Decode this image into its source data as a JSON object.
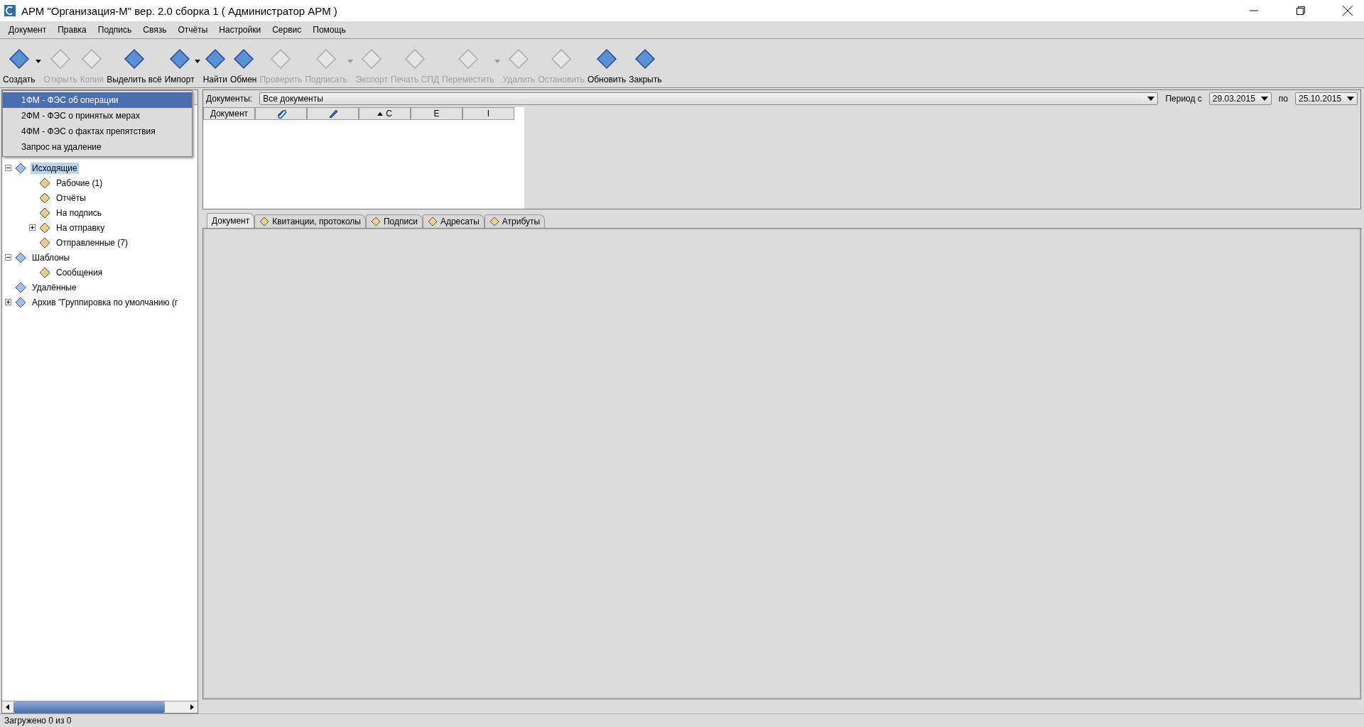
{
  "window": {
    "title": "АРМ \"Организация-М\" вер. 2.0 сборка 1 ( Администратор АРМ )"
  },
  "menu_bar": [
    "Документ",
    "Правка",
    "Подпись",
    "Связь",
    "Отчёты",
    "Настройки",
    "Сервис",
    "Помощь"
  ],
  "toolbar": {
    "buttons": [
      {
        "label": "Создать",
        "disabled": false,
        "dropdown": true
      },
      {
        "label": "Открыть",
        "disabled": true,
        "dropdown": false
      },
      {
        "label": "Копия",
        "disabled": true,
        "dropdown": false
      },
      {
        "label": "Выделить всё",
        "disabled": false,
        "dropdown": false
      },
      {
        "label": "Импорт",
        "disabled": false,
        "dropdown": true
      },
      {
        "label": "Найти",
        "disabled": false,
        "dropdown": false
      },
      {
        "label": "Обмен",
        "disabled": false,
        "dropdown": false
      },
      {
        "label": "Проверить",
        "disabled": true,
        "dropdown": false
      },
      {
        "label": "Подписать",
        "disabled": true,
        "dropdown": true
      },
      {
        "label": "Экспорт",
        "disabled": true,
        "dropdown": false
      },
      {
        "label": "Печать СПД",
        "disabled": true,
        "dropdown": false
      },
      {
        "label": "Переместить",
        "disabled": true,
        "dropdown": true
      },
      {
        "label": "Удалить",
        "disabled": true,
        "dropdown": false
      },
      {
        "label": "Остановить",
        "disabled": true,
        "dropdown": false
      },
      {
        "label": "Обновить",
        "disabled": false,
        "dropdown": false
      },
      {
        "label": "Закрыть",
        "disabled": false,
        "dropdown": false
      }
    ]
  },
  "create_menu": {
    "items": [
      {
        "label": "1ФМ - ФЭС об операции",
        "selected": true
      },
      {
        "label": "2ФМ - ФЭС о принятых мерах",
        "selected": false
      },
      {
        "label": "4ФМ - ФЭС о фактах препятствия",
        "selected": false
      },
      {
        "label": "Запрос на удаление",
        "selected": false
      }
    ]
  },
  "tree": [
    {
      "label": "Исходящие",
      "selected": true,
      "expanded": true,
      "children": [
        {
          "label": "Рабочие (1)",
          "selected": false
        },
        {
          "label": "Отчёты",
          "selected": false
        },
        {
          "label": "На подпись",
          "selected": false
        },
        {
          "label": "На отправку",
          "selected": false,
          "expanded": false
        },
        {
          "label": "Отправленные (7)",
          "selected": false
        }
      ]
    },
    {
      "label": "Шаблоны",
      "selected": false,
      "expanded": true,
      "children": [
        {
          "label": "Сообщения",
          "selected": false
        }
      ]
    },
    {
      "label": "Удалённые",
      "selected": false
    },
    {
      "label": "Архив \"Группировка по умолчанию (г",
      "selected": false,
      "expanded": false
    }
  ],
  "filter": {
    "label": "Документы:",
    "value": "Все документы",
    "period_label": "Период с",
    "date_from": "29.03.2015",
    "to_label": "по",
    "date_to": "25.10.2015"
  },
  "table": {
    "columns": [
      {
        "kind": "text",
        "label": "Документ"
      },
      {
        "kind": "attachment"
      },
      {
        "kind": "signature"
      },
      {
        "kind": "text",
        "label": "C",
        "sorted": true
      },
      {
        "kind": "text",
        "label": "E"
      },
      {
        "kind": "text",
        "label": "I"
      }
    ]
  },
  "tabs": [
    {
      "label": "Документ",
      "selected": true
    },
    {
      "label": "Квитанции, протоколы",
      "selected": false
    },
    {
      "label": "Подписи",
      "selected": false
    },
    {
      "label": "Адресаты",
      "selected": false
    },
    {
      "label": "Атрибуты",
      "selected": false
    }
  ],
  "status_bar": "Загружено 0 из 0"
}
